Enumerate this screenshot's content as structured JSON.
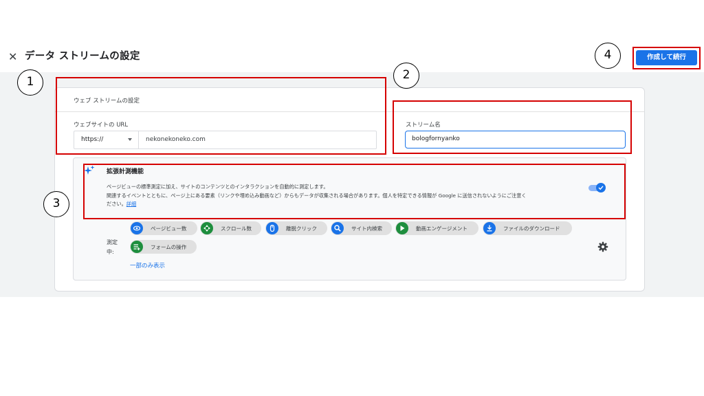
{
  "header": {
    "close_icon": "✕",
    "title": "データ ストリームの設定",
    "create_button": "作成して続行"
  },
  "web_stream": {
    "section_title": "ウェブ ストリームの設定",
    "url_label": "ウェブサイトの URL",
    "protocol_value": "https://",
    "url_value": "nekonekoneko.com",
    "stream_name_label": "ストリーム名",
    "stream_name_value": "bologfornyanko"
  },
  "enhanced": {
    "title": "拡張計測機能",
    "desc_line1": "ページビューの標準測定に加え、サイトのコンテンツとのインタラクションを自動的に測定します。",
    "desc_line2": "関連するイベントとともに、ページ上にある要素（リンクや埋め込み動画など）からもデータが収集される場合があります。個人を特定できる情報が Google に送信されないようにご注意く",
    "desc_line3": "ださい。",
    "details_link": "詳細",
    "toggle_on": true,
    "measuring_label": "測定中:",
    "chips": [
      {
        "label": "ページビュー数",
        "icon": "eye-icon",
        "color": "#1a73e8"
      },
      {
        "label": "スクロール数",
        "icon": "crosshair-icon",
        "color": "#1e8e3e"
      },
      {
        "label": "離脱クリック",
        "icon": "mouse-icon",
        "color": "#1a73e8"
      },
      {
        "label": "サイト内検索",
        "icon": "search-icon",
        "color": "#1a73e8"
      },
      {
        "label": "動画エンゲージメント",
        "icon": "play-icon",
        "color": "#1e8e3e"
      },
      {
        "label": "ファイルのダウンロード",
        "icon": "download-icon",
        "color": "#1a73e8"
      },
      {
        "label": "フォームの操作",
        "icon": "form-icon",
        "color": "#1e8e3e"
      }
    ],
    "show_less": "一部のみ表示"
  },
  "annotations": [
    "1",
    "2",
    "3",
    "4"
  ]
}
